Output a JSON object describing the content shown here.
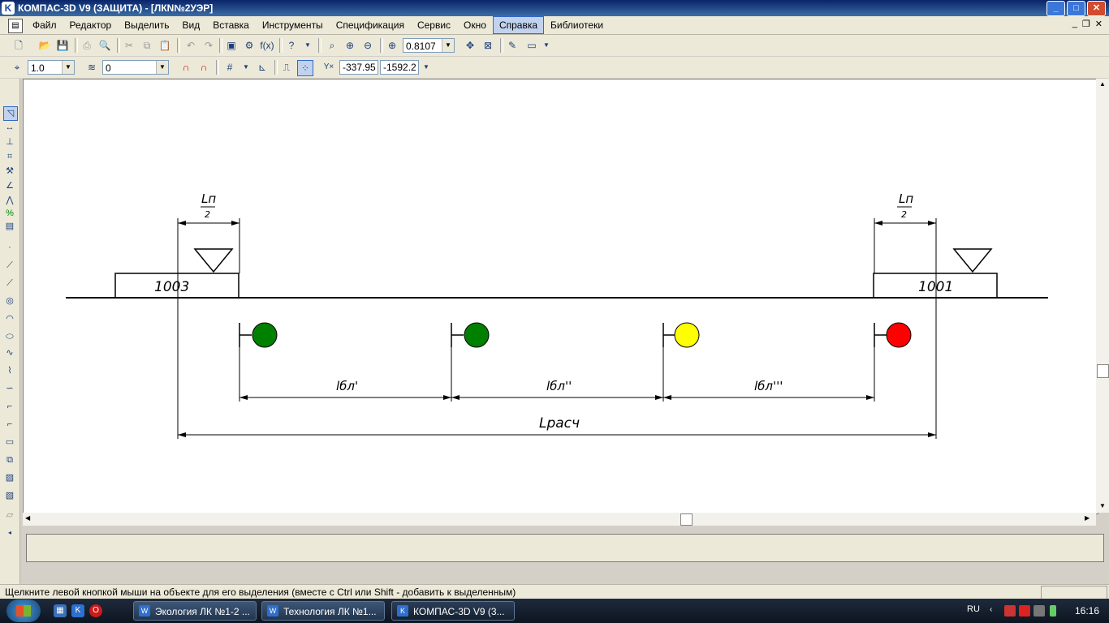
{
  "window": {
    "title": "КОМПАС-3D V9 (ЗАЩИТА) - [ЛКN№2УЭР]",
    "min": "_",
    "max": "□",
    "close": "✕"
  },
  "menu": [
    "Файл",
    "Редактор",
    "Выделить",
    "Вид",
    "Вставка",
    "Инструменты",
    "Спецификация",
    "Сервис",
    "Окно",
    "Справка",
    "Библиотеки"
  ],
  "menu_active": "Справка",
  "toolbar1": {
    "zoom_value": "0.8107"
  },
  "toolbar2": {
    "line_scale": "1.0",
    "layer": "0",
    "coord_x": "-337.95",
    "coord_y": "-1592.2"
  },
  "drawing": {
    "station_left": "1003",
    "station_right": "1001",
    "dim_half_numer": "Lп",
    "dim_half_denom": "2",
    "dim_b1": "lбл'",
    "dim_b2": "lбл''",
    "dim_b3": "lбл'''",
    "dim_total": "Lрасч",
    "signal_colors": [
      "#008000",
      "#008000",
      "#ffff00",
      "#ff0000"
    ]
  },
  "status_text": "Щелкните левой кнопкой мыши на объекте для его выделения (вместе с Ctrl или Shift - добавить к выделенным)",
  "taskbar": {
    "tasks": [
      "Экология ЛК №1-2 ...",
      "Технология ЛК №1...",
      "КОМПАС-3D V9 (3..."
    ],
    "lang": "RU",
    "clock": "16:16"
  }
}
